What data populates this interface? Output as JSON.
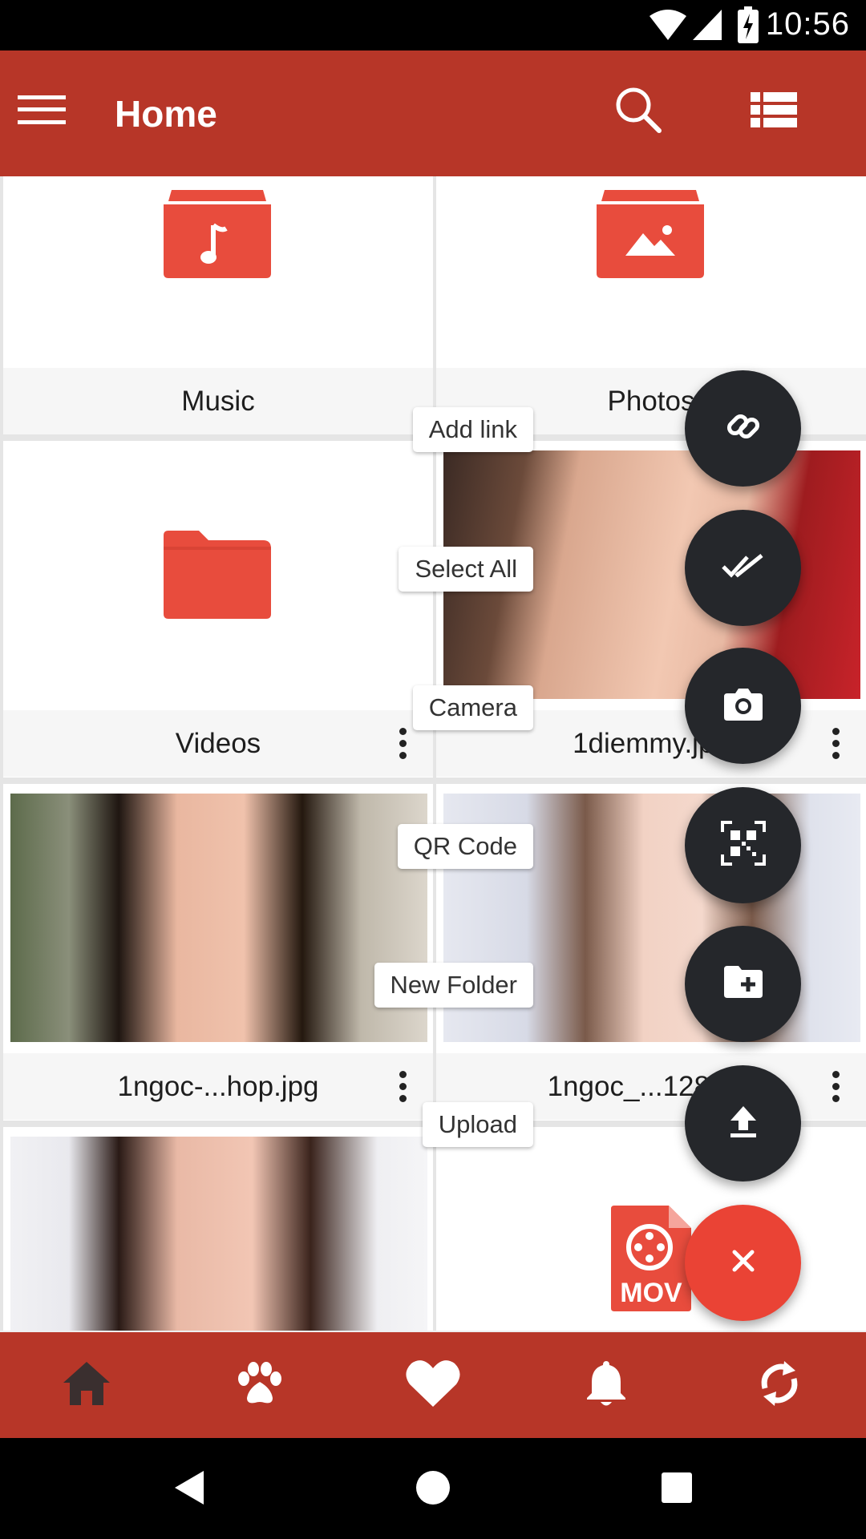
{
  "status_bar": {
    "time": "10:56",
    "icons": [
      "wifi-icon",
      "cell-signal-icon",
      "battery-charging-icon"
    ]
  },
  "app_bar": {
    "title": "Home",
    "icons": [
      "menu-icon",
      "search-icon",
      "list-view-icon"
    ]
  },
  "grid": {
    "items": [
      {
        "name": "Music",
        "type": "folder",
        "icon": "music-folder-icon"
      },
      {
        "name": "Photos",
        "type": "folder",
        "icon": "photo-folder-icon"
      },
      {
        "name": "Videos",
        "type": "folder",
        "icon": "folder-icon"
      },
      {
        "name": "1diemmy.jpg",
        "type": "image"
      },
      {
        "name": "1ngoc-...hop.jpg",
        "type": "image"
      },
      {
        "name": "1ngoc_...128.jpg",
        "type": "image"
      },
      {
        "name": "",
        "type": "image"
      },
      {
        "name": "",
        "type": "video",
        "icon": "mov-file-icon",
        "badge": "MOV"
      }
    ]
  },
  "fab_menu": {
    "actions": [
      {
        "label": "Add link",
        "icon": "link-icon"
      },
      {
        "label": "Select All",
        "icon": "double-check-icon"
      },
      {
        "label": "Camera",
        "icon": "camera-icon"
      },
      {
        "label": "QR Code",
        "icon": "qr-code-icon"
      },
      {
        "label": "New Folder",
        "icon": "new-folder-icon"
      },
      {
        "label": "Upload",
        "icon": "upload-icon"
      }
    ],
    "close_icon": "close-icon"
  },
  "bottom_nav": {
    "items": [
      "home-icon",
      "paw-icon",
      "heart-icon",
      "bell-icon",
      "sync-icon"
    ],
    "active": "home-icon"
  },
  "system_nav": [
    "back-icon",
    "home-circle-icon",
    "recents-icon"
  ],
  "colors": {
    "primary": "#b73628",
    "accent": "#ea4335",
    "fab_dark": "#25272b",
    "folder": "#e84c3d",
    "active_nav": "#3a2f2f"
  }
}
